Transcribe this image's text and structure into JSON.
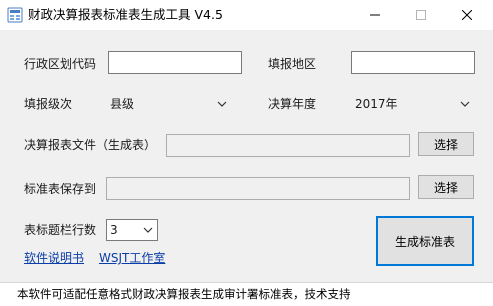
{
  "window": {
    "title": "财政决算报表标准表生成工具 V4.5",
    "accent": "#0078d7"
  },
  "form": {
    "region_code": {
      "label": "行政区划代码",
      "value": ""
    },
    "region_name": {
      "label": "填报地区",
      "value": ""
    },
    "level": {
      "label": "填报级次",
      "value": "县级"
    },
    "year": {
      "label": "决算年度",
      "value": "2017年"
    },
    "source_file": {
      "label": "决算报表文件（生成表）",
      "value": "",
      "button": "选择"
    },
    "output_dir": {
      "label": "标准表保存到",
      "value": "",
      "button": "选择"
    },
    "header_rows": {
      "label": "表标题栏行数",
      "value": "3"
    },
    "generate_button": "生成标准表"
  },
  "links": {
    "manual": "软件说明书",
    "studio": "WSJT工作室"
  },
  "status": {
    "text": "本软件可适配任意格式财政决算报表生成审计署标准表，技术支持"
  }
}
